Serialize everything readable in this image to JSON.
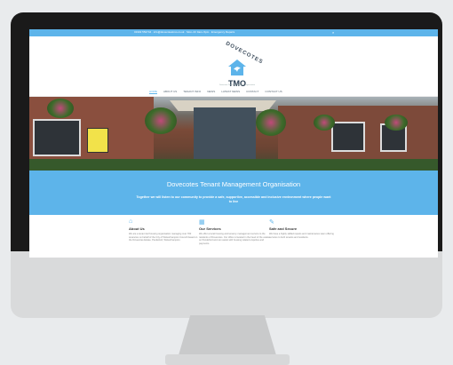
{
  "site": {
    "topbar_text": "01902 552744  ·  info@dovecotestmo.co.uk  ·  Mon–Fri 9am–5pm  ·  Emergency Repairs",
    "logo_arc": "DOVECOTES",
    "logo_tmo": "TMO",
    "tagline": "Dovecotes Tenant Management Organisation",
    "nav": [
      "HOME",
      "ABOUT US",
      "TENANT INFO",
      "NEWS",
      "LATEST NEWS",
      "CONTACT",
      "CONTACT US"
    ],
    "band_title": "Dovecotes Tenant Management Organisation",
    "band_subtitle": "Together we will listen to our community to provide a safe, supportive, accessible and inclusive environment where people want to live",
    "columns": [
      {
        "icon": "house-icon",
        "title": "About Us",
        "text": "We are a tenant led housing organisation managing over 700 tenancies on behalf of the City of Wolverhampton Council based on the Dovecotes Estate, Pendeford, Wolverhampton."
      },
      {
        "icon": "grid-icon",
        "title": "Our Services",
        "text": "We offer a local housing and tenancy management service to the residents of Dovecotes. Our office is located in the heart of the estate on Pendeford and can assist with housing related enquiries and payments."
      },
      {
        "icon": "wrench-icon",
        "title": "Safe and Secure",
        "text": "We have a highly skilled repairs and maintenance team offering services to both tenants and residents."
      }
    ],
    "colors": {
      "accent": "#5db4ea",
      "bezel": "#1a1a1a",
      "chin": "#d9dadb"
    }
  }
}
